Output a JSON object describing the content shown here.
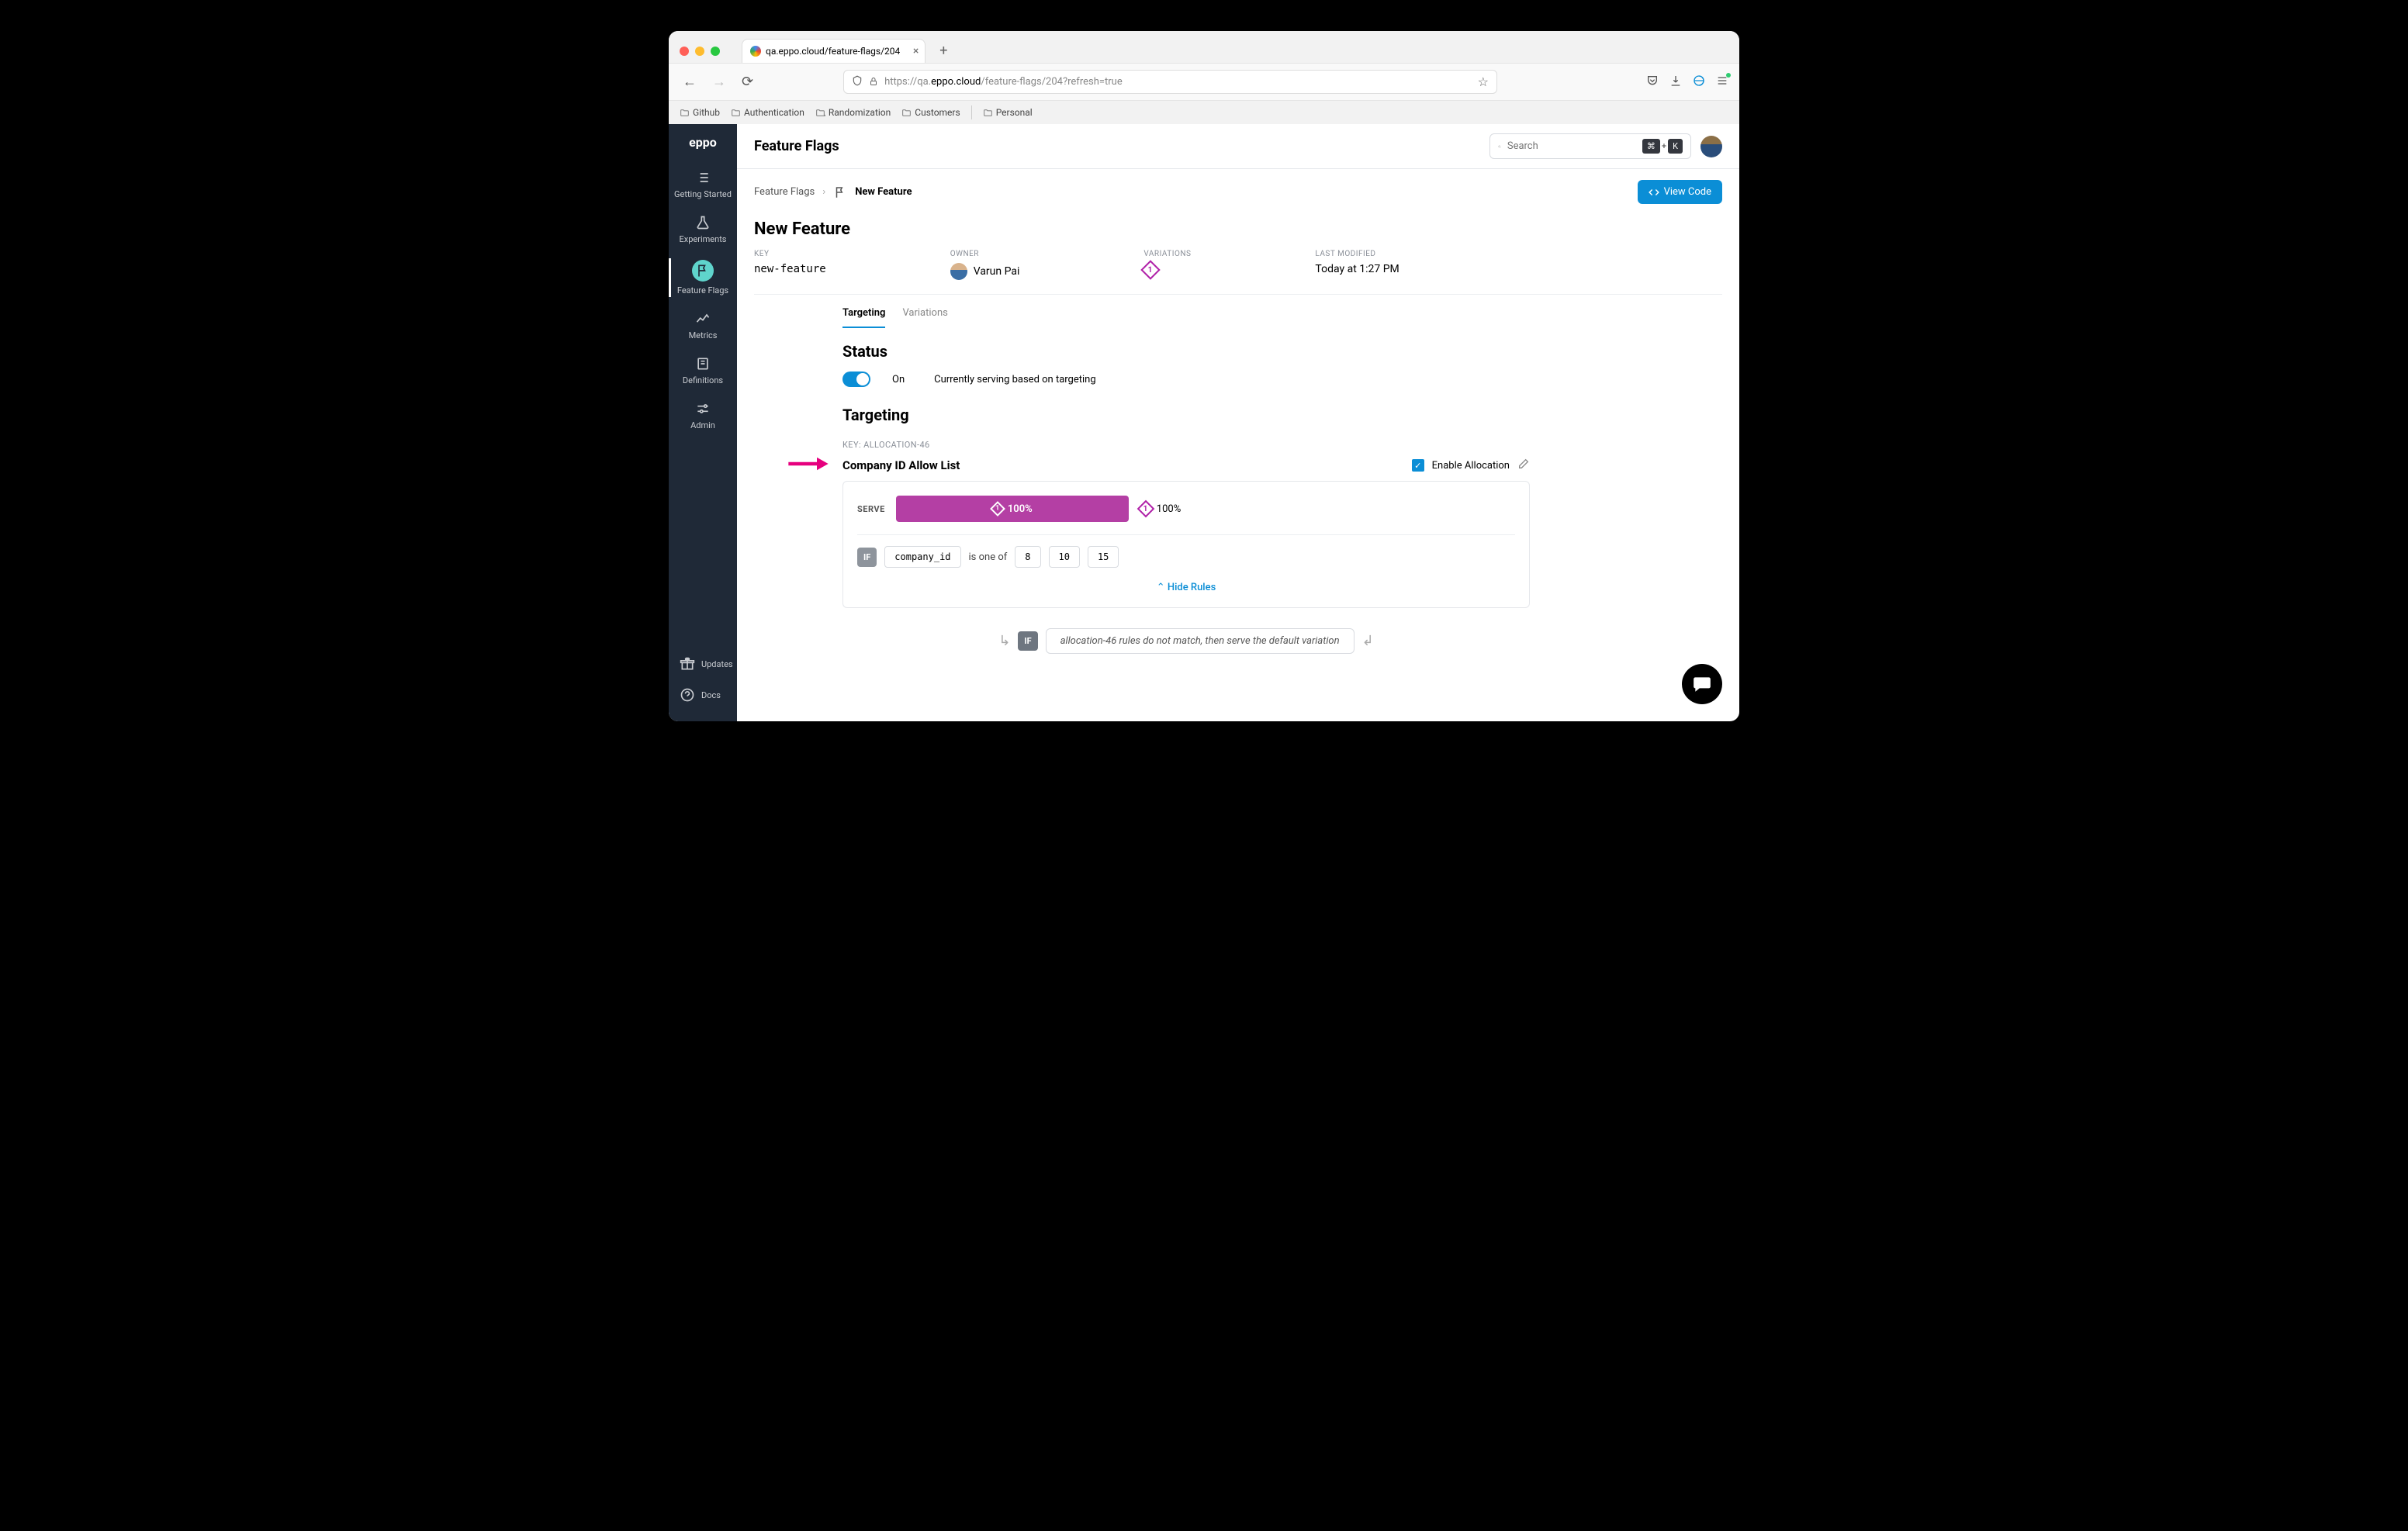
{
  "browser": {
    "tab_title": "qa.eppo.cloud/feature-flags/204",
    "url_prefix": "https://qa.",
    "url_host": "eppo.cloud",
    "url_path": "/feature-flags/204?refresh=true",
    "bookmarks": [
      "Github",
      "Authentication",
      "Randomization",
      "Customers",
      "Personal"
    ]
  },
  "sidebar": {
    "logo": "eppo",
    "items": [
      {
        "label": "Getting Started"
      },
      {
        "label": "Experiments"
      },
      {
        "label": "Feature Flags"
      },
      {
        "label": "Metrics"
      },
      {
        "label": "Definitions"
      },
      {
        "label": "Admin"
      }
    ],
    "footer": [
      {
        "label": "Updates"
      },
      {
        "label": "Docs"
      }
    ]
  },
  "header": {
    "title": "Feature Flags",
    "search_placeholder": "Search",
    "kbd1": "⌘",
    "kbdplus": "+",
    "kbd2": "K"
  },
  "breadcrumbs": {
    "root": "Feature Flags",
    "current": "New Feature",
    "view_code": "View Code"
  },
  "page": {
    "title": "New Feature",
    "meta": {
      "key_label": "KEY",
      "key": "new-feature",
      "owner_label": "OWNER",
      "owner": "Varun Pai",
      "variations_label": "VARIATIONS",
      "variations_num": "1",
      "modified_label": "LAST MODIFIED",
      "modified": "Today at 1:27 PM"
    },
    "tabs": {
      "targeting": "Targeting",
      "variations": "Variations"
    },
    "status": {
      "heading": "Status",
      "on": "On",
      "desc": "Currently serving based on targeting"
    },
    "targeting": {
      "heading": "Targeting",
      "alloc_key": "KEY: ALLOCATION-46",
      "alloc_name": "Company ID Allow List",
      "enable": "Enable Allocation",
      "serve_label": "SERVE",
      "bar_pct": "100%",
      "bar_num": "1",
      "outside_pct": "100%",
      "outside_num": "1",
      "if": "IF",
      "attr": "company_id",
      "op": "is one of",
      "vals": [
        "8",
        "10",
        "15"
      ],
      "hide": "Hide Rules",
      "default_if": "IF",
      "default_text": "allocation-46 rules do not match, then serve the default variation"
    }
  }
}
